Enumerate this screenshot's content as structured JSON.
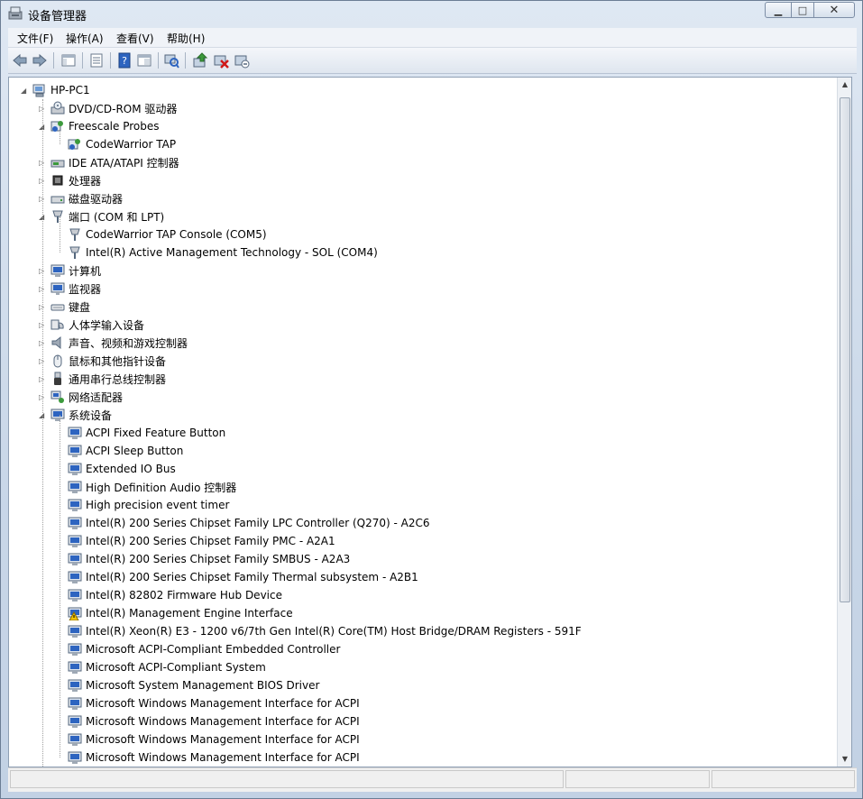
{
  "window": {
    "title": "设备管理器"
  },
  "menu": [
    "文件(F)",
    "操作(A)",
    "查看(V)",
    "帮助(H)"
  ],
  "toolbar": [
    "back-icon",
    "forward-icon",
    "show-hide-console-tree-icon",
    "properties-icon",
    "help-icon",
    "view-icon",
    "scan-hardware-icon",
    "update-driver-icon",
    "uninstall-icon",
    "disable-icon"
  ],
  "tree": {
    "root": "HP-PC1",
    "categories": [
      {
        "label": "DVD/CD-ROM 驱动器",
        "icon": "dvd-drive-icon",
        "expanded": false,
        "children": []
      },
      {
        "label": "Freescale Probes",
        "icon": "probe-icon",
        "expanded": true,
        "children": [
          {
            "label": "CodeWarrior TAP",
            "icon": "probe-device-icon"
          }
        ]
      },
      {
        "label": "IDE ATA/ATAPI 控制器",
        "icon": "ide-controller-icon",
        "expanded": false,
        "children": []
      },
      {
        "label": "处理器",
        "icon": "processor-icon",
        "expanded": false,
        "children": []
      },
      {
        "label": "磁盘驱动器",
        "icon": "disk-drive-icon",
        "expanded": false,
        "children": []
      },
      {
        "label": "端口 (COM 和 LPT)",
        "icon": "port-icon",
        "expanded": true,
        "children": [
          {
            "label": "CodeWarrior TAP Console (COM5)",
            "icon": "port-device-icon"
          },
          {
            "label": "Intel(R) Active Management Technology - SOL (COM4)",
            "icon": "port-device-icon"
          }
        ]
      },
      {
        "label": "计算机",
        "icon": "computer-icon",
        "expanded": false,
        "children": []
      },
      {
        "label": "监视器",
        "icon": "monitor-icon",
        "expanded": false,
        "children": []
      },
      {
        "label": "键盘",
        "icon": "keyboard-icon",
        "expanded": false,
        "children": []
      },
      {
        "label": "人体学输入设备",
        "icon": "hid-icon",
        "expanded": false,
        "children": []
      },
      {
        "label": "声音、视频和游戏控制器",
        "icon": "speaker-icon",
        "expanded": false,
        "children": []
      },
      {
        "label": "鼠标和其他指针设备",
        "icon": "mouse-icon",
        "expanded": false,
        "children": []
      },
      {
        "label": "通用串行总线控制器",
        "icon": "usb-icon",
        "expanded": false,
        "children": []
      },
      {
        "label": "网络适配器",
        "icon": "network-adapter-icon",
        "expanded": false,
        "children": []
      },
      {
        "label": "系统设备",
        "icon": "system-devices-icon",
        "expanded": true,
        "children": [
          {
            "label": "ACPI Fixed Feature Button",
            "icon": "system-device-icon"
          },
          {
            "label": "ACPI Sleep Button",
            "icon": "system-device-icon"
          },
          {
            "label": "Extended IO Bus",
            "icon": "system-device-icon"
          },
          {
            "label": "High Definition Audio 控制器",
            "icon": "system-device-icon"
          },
          {
            "label": "High precision event timer",
            "icon": "system-device-icon"
          },
          {
            "label": "Intel(R) 200 Series Chipset Family LPC Controller (Q270) - A2C6",
            "icon": "system-device-icon"
          },
          {
            "label": "Intel(R) 200 Series Chipset Family PMC - A2A1",
            "icon": "system-device-icon"
          },
          {
            "label": "Intel(R) 200 Series Chipset Family SMBUS - A2A3",
            "icon": "system-device-icon"
          },
          {
            "label": "Intel(R) 200 Series Chipset Family Thermal subsystem - A2B1",
            "icon": "system-device-icon"
          },
          {
            "label": "Intel(R) 82802 Firmware Hub Device",
            "icon": "system-device-icon"
          },
          {
            "label": "Intel(R) Management Engine Interface",
            "icon": "system-device-warning-icon"
          },
          {
            "label": "Intel(R) Xeon(R) E3 - 1200 v6/7th Gen Intel(R) Core(TM) Host Bridge/DRAM Registers - 591F",
            "icon": "system-device-icon"
          },
          {
            "label": "Microsoft ACPI-Compliant Embedded Controller",
            "icon": "system-device-icon"
          },
          {
            "label": "Microsoft ACPI-Compliant System",
            "icon": "system-device-icon"
          },
          {
            "label": "Microsoft System Management BIOS Driver",
            "icon": "system-device-icon"
          },
          {
            "label": "Microsoft Windows Management Interface for ACPI",
            "icon": "system-device-icon"
          },
          {
            "label": "Microsoft Windows Management Interface for ACPI",
            "icon": "system-device-icon"
          },
          {
            "label": "Microsoft Windows Management Interface for ACPI",
            "icon": "system-device-icon"
          },
          {
            "label": "Microsoft Windows Management Interface for ACPI",
            "icon": "system-device-icon"
          }
        ]
      }
    ]
  },
  "colors": {
    "accent": "#2a5ea8",
    "warning": "#f2c200",
    "selection": "#cce4f7"
  }
}
